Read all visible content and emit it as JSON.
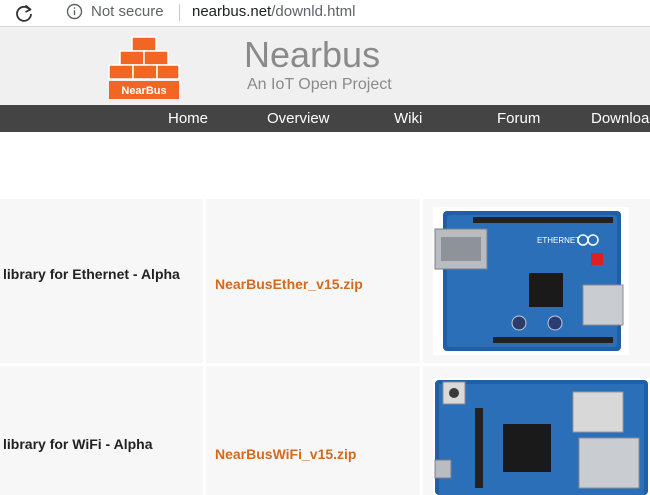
{
  "browser": {
    "security_label": "Not secure",
    "url_host": "nearbus.net",
    "url_path": "/downld.html"
  },
  "header": {
    "logo_text": "NearBus",
    "title": "Nearbus",
    "subtitle": "An IoT Open Project"
  },
  "nav": {
    "items": [
      "Home",
      "Overview",
      "Wiki",
      "Forum",
      "Download"
    ]
  },
  "downloads": [
    {
      "name": "library for Ethernet - Alpha",
      "file": "NearBusEther_v15.zip",
      "image_icon": "arduino-ethernet-shield-photo"
    },
    {
      "name": "library for WiFi - Alpha",
      "file": "NearBusWiFi_v15.zip",
      "image_icon": "arduino-wifi-shield-photo"
    }
  ],
  "colors": {
    "nav_bg": "#444444",
    "link": "#d46a1e",
    "logo_orange": "#f26522"
  }
}
